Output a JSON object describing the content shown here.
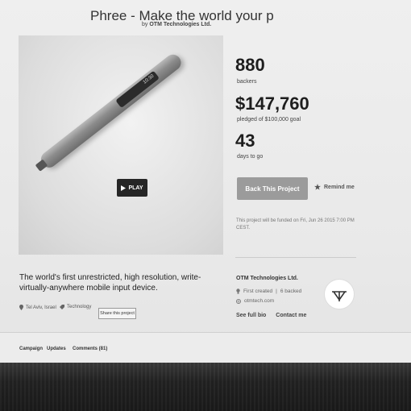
{
  "project": {
    "title": "Phree - Make the world your p",
    "by_prefix": "by",
    "creator": "OTM Technologies Ltd."
  },
  "video": {
    "play_label": "PLAY",
    "pen_display": "10:30"
  },
  "stats": {
    "backers_count": "880",
    "backers_label": "backers",
    "pledged_amount": "$147,760",
    "pledged_label": "pledged of $100,000 goal",
    "days_count": "43",
    "days_label": "days to go"
  },
  "actions": {
    "back_label": "Back This Project",
    "remind_label": "Remind me",
    "funding_note": "This project will be funded on Fri, Jun 26 2015 7:00 PM CEST."
  },
  "description": {
    "text": "The world's first unrestricted, high resolution, write-virtually-anywhere mobile input device.",
    "location": "Tel Aviv, Israel",
    "category": "Technology",
    "share_label": "Share this project"
  },
  "creator": {
    "name": "OTM Technologies Ltd.",
    "first_created": "First created",
    "backed": "6 backed",
    "website": "otmtech.com",
    "bio_link": "See full bio",
    "contact_link": "Contact me"
  },
  "tabs": [
    {
      "label": "Campaign"
    },
    {
      "label": "Updates"
    },
    {
      "label": "Comments (81)"
    }
  ],
  "colors": {
    "accent": "#9b9b9b",
    "page_bg": "#efefef",
    "bottom_strip": "#222222"
  }
}
